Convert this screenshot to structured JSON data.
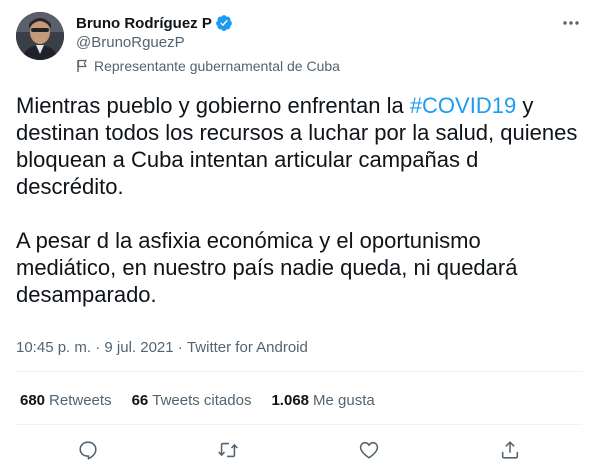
{
  "author": {
    "name": "Bruno Rodríguez P",
    "handle": "@BrunoRguezP",
    "label": "Representante gubernamental de Cuba"
  },
  "tweet": {
    "para1_before": "Mientras pueblo y gobierno enfrentan la ",
    "hashtag": "#COVID19",
    "para1_after": " y destinan todos los recursos a luchar por la salud, quienes bloquean a Cuba intentan articular campañas d descrédito.",
    "para2": "A pesar d la asfixia económica y el oportunismo mediático, en nuestro país nadie queda, ni quedará desamparado."
  },
  "meta": {
    "time": "10:45 p. m.",
    "sep1": " · ",
    "date": "9 jul. 2021",
    "sep2": " · ",
    "source": "Twitter for Android"
  },
  "stats": {
    "retweets_count": "680",
    "retweets_label": "Retweets",
    "quotes_count": "66",
    "quotes_label": "Tweets citados",
    "likes_count": "1.068",
    "likes_label": "Me gusta"
  },
  "colors": {
    "accent": "#1d9bf0",
    "text": "#0f1419",
    "secondary": "#536471",
    "divider": "#eff3f4"
  },
  "icons": [
    "verified-badge-icon",
    "more-options-icon",
    "flag-icon",
    "reply-icon",
    "retweet-icon",
    "like-icon",
    "share-icon"
  ]
}
